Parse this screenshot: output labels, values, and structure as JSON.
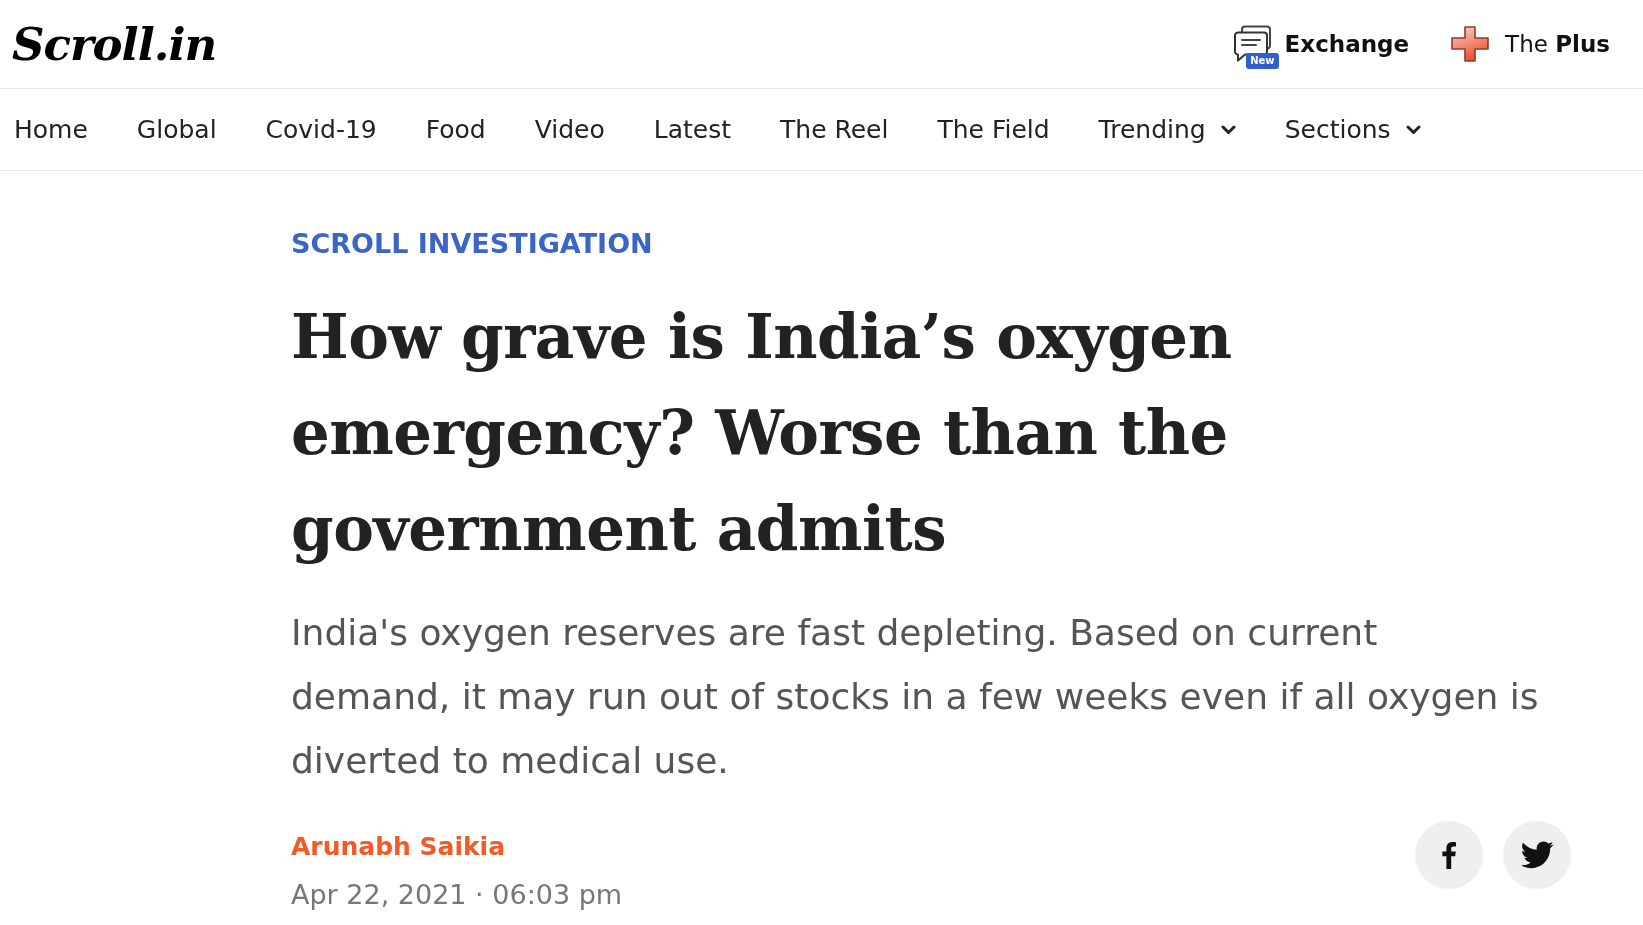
{
  "header": {
    "logo": "Scroll.in",
    "links": [
      {
        "kind": "exchange",
        "label": "Exchange",
        "badge": "New"
      },
      {
        "kind": "plus",
        "label": "The **Plus**"
      }
    ]
  },
  "nav": {
    "items": [
      {
        "label": "Home",
        "dropdown": false
      },
      {
        "label": "Global",
        "dropdown": false
      },
      {
        "label": "Covid-19",
        "dropdown": false
      },
      {
        "label": "Food",
        "dropdown": false
      },
      {
        "label": "Video",
        "dropdown": false
      },
      {
        "label": "Latest",
        "dropdown": false
      },
      {
        "label": "The Reel",
        "dropdown": false
      },
      {
        "label": "The Field",
        "dropdown": false
      },
      {
        "label": "Trending",
        "dropdown": true
      },
      {
        "label": "Sections",
        "dropdown": true
      }
    ]
  },
  "article": {
    "category": "SCROLL INVESTIGATION",
    "headline": "How grave is India’s oxygen emergency? Worse than the government admits",
    "standfirst": "India's oxygen reserves are fast depleting. Based on current demand, it may run out of stocks in a few weeks even if all oxygen is diverted to medical use.",
    "author": "Arunabh Saikia",
    "date": "Apr 22, 2021 · 06:03 pm"
  },
  "share_buttons": [
    {
      "kind": "facebook"
    },
    {
      "kind": "twitter"
    }
  ]
}
